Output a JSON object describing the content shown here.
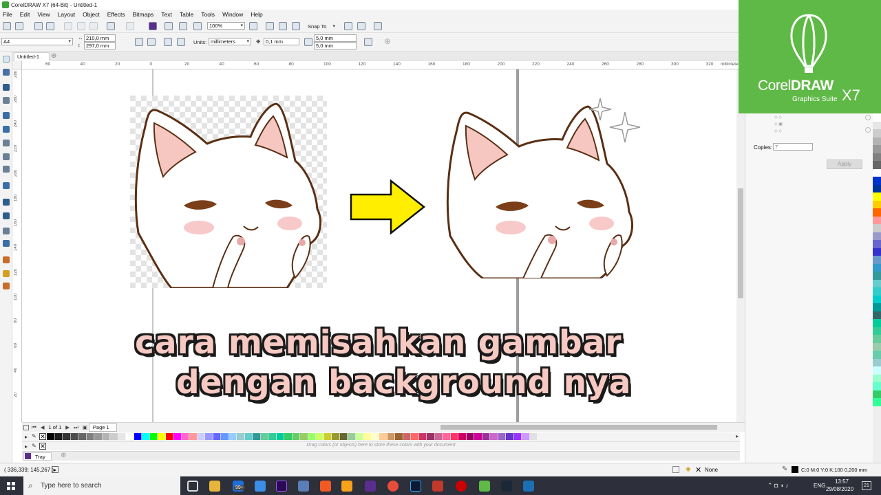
{
  "window": {
    "title": "CorelDRAW X7 (64-Bit) - Untitled-1"
  },
  "menu": [
    "File",
    "Edit",
    "View",
    "Layout",
    "Object",
    "Effects",
    "Bitmaps",
    "Text",
    "Table",
    "Tools",
    "Window",
    "Help"
  ],
  "toolbar": {
    "zoom_value": "100%",
    "snap_to_label": "Snap To"
  },
  "property_bar": {
    "page_size": "A4",
    "width": "210,0 mm",
    "height": "297,0 mm",
    "units_label": "Units:",
    "units_value": "millimeters",
    "nudge": "0,1 mm",
    "dup_x": "5,0 mm",
    "dup_y": "5,0 mm"
  },
  "document": {
    "tab_name": "Untitled-1",
    "ruler_unit": "millimeters"
  },
  "ruler_h_ticks": [
    "60",
    "40",
    "20",
    "0",
    "20",
    "40",
    "60",
    "80",
    "100",
    "120",
    "140",
    "160",
    "180",
    "200",
    "220",
    "240",
    "260",
    "280",
    "300",
    "320",
    "millimeters"
  ],
  "ruler_v_ticks": [
    "280",
    "260",
    "240",
    "220",
    "200",
    "180",
    "160",
    "140",
    "120",
    "100",
    "80",
    "60",
    "40",
    "20"
  ],
  "page_nav": {
    "counter": "1 of 1",
    "page_tab": "Page 1"
  },
  "color_tray": {
    "hint": "Drag colors (or objects) here to store these colors with your document",
    "tab_label": "Tray"
  },
  "docker": {
    "copies_label": "Copies:",
    "copies_value": "7",
    "apply_label": "Apply"
  },
  "status": {
    "cursor_pos": "( 336,339; 145,267 )",
    "fill_label": "None",
    "outline_label": "C:0 M:0 Y:0 K:100  0,200 mm"
  },
  "taskbar": {
    "search_placeholder": "Type here to search",
    "badge_count": "99+",
    "lang": "ENG",
    "time": "13:57",
    "date": "29/08/2020",
    "notif_count": "21"
  },
  "brand": {
    "name_light": "Corel",
    "name_bold": "DRAW",
    "version": "X7",
    "suite": "Graphics Suite"
  },
  "caption": {
    "line1": "cara memisahkan gambar",
    "line2": "dengan background nya"
  },
  "colors": {
    "accent_green": "#5fb946",
    "arrow_yellow": "#ffee00",
    "caption_fill": "#f6c9c2"
  },
  "palette": [
    "#000000",
    "#1a1a1a",
    "#333333",
    "#4d4d4d",
    "#666666",
    "#808080",
    "#999999",
    "#b3b3b3",
    "#cccccc",
    "#e6e6e6",
    "#ffffff",
    "#0000ff",
    "#00ffff",
    "#00ff00",
    "#ffff00",
    "#ff0000",
    "#ff00ff",
    "#ff66cc",
    "#ff9999",
    "#ccccff",
    "#9999ff",
    "#6666ff",
    "#6699ff",
    "#99ccff",
    "#99cccc",
    "#66cccc",
    "#339999",
    "#66cc99",
    "#33cc99",
    "#00cc99",
    "#33cc66",
    "#66cc66",
    "#99cc66",
    "#99ff66",
    "#ccff66",
    "#cccc33",
    "#999933",
    "#666633",
    "#99cc99",
    "#ccff99",
    "#ffff99",
    "#ffffcc",
    "#ffcc99",
    "#cc9966",
    "#996633",
    "#cc6666",
    "#ff6666",
    "#cc3366",
    "#993366",
    "#cc6699",
    "#ff6699",
    "#ff3366",
    "#cc0066",
    "#990066",
    "#cc0099",
    "#993399",
    "#cc66cc",
    "#9966cc",
    "#6633cc",
    "#9933ff",
    "#cc99ff",
    "#e0e0e0"
  ],
  "right_palette": [
    "#ffffff",
    "#e6e6e6",
    "#cccccc",
    "#b3b3b3",
    "#999999",
    "#808080",
    "#666666",
    "#ffffff",
    "#0033cc",
    "#003399",
    "#ffff00",
    "#ffcc00",
    "#ff6600",
    "#ff9999",
    "#cccccc",
    "#9999cc",
    "#6666cc",
    "#3333cc",
    "#6699cc",
    "#3399cc",
    "#339999",
    "#66cccc",
    "#33cccc",
    "#00cccc",
    "#009999",
    "#336666",
    "#00cc99",
    "#33cc99",
    "#66cc99",
    "#99ccaa",
    "#66ccaa",
    "#99cccc",
    "#ccffff",
    "#99ffcc",
    "#66ffcc",
    "#33cc66",
    "#33ff99"
  ]
}
